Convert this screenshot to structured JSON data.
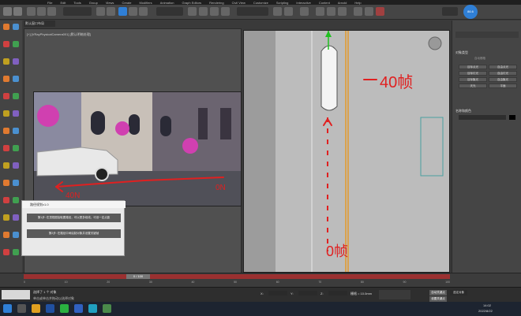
{
  "app": {
    "menu_items": [
      "File",
      "Edit",
      "Tools",
      "Group",
      "Views",
      "Create",
      "Modifiers",
      "Animation",
      "Graph Editors",
      "Rendering",
      "Civil View",
      "Customize",
      "Scripting",
      "Interactive",
      "Content",
      "Arnold",
      "Help"
    ],
    "workspace_tab": "默认窗口布局",
    "user_badge": "86.6"
  },
  "viewport_left": {
    "label": "[+] [VRayPhysicalCamera001] [默认明暗处理]"
  },
  "viewport_right": {
    "annotation_top": "40帧",
    "annotation_bottom": "0帧"
  },
  "render_overlay": {
    "note_left": "40N",
    "note_right": "0N"
  },
  "command_panel": {
    "object_type_header": "对象类型",
    "autogrid": "自动栅格",
    "name_color_header": "名称和颜色",
    "buttons": [
      "目标点光",
      "自由点光",
      "目标灯光",
      "自由灯光",
      "目标聚光",
      "自由聚光",
      "天光",
      "平面"
    ]
  },
  "dialog": {
    "title": "路径规划v1.0",
    "button1": "第1步: 在顶视图拾取要路径，可以是多段线，可设一定点距",
    "button2": "第2步: 在路径中间绘制对象并设置关键帧"
  },
  "timeline": {
    "frame_counter": "0 / 100",
    "ticks": [
      "0",
      "10",
      "20",
      "30",
      "40",
      "50",
      "60",
      "70",
      "80",
      "90",
      "100"
    ]
  },
  "status": {
    "selection": "选择了 1 个 对象",
    "hint": "单击或单击并拖动以选择对象",
    "x_label": "X:",
    "y_label": "Y:",
    "z_label": "Z:",
    "grid": "栅格 = 10.0mm",
    "auto_key": "自动关键点",
    "selected_obj": "选定对象",
    "set_key": "设置关键点"
  },
  "taskbar": {
    "time": "14:02",
    "date": "2022/8/22"
  },
  "colors": {
    "ink_red": "#e02020",
    "timeline_red": "#9a3030",
    "gizmo_green": "#20c020",
    "accent_blue": "#2f7fd6"
  }
}
